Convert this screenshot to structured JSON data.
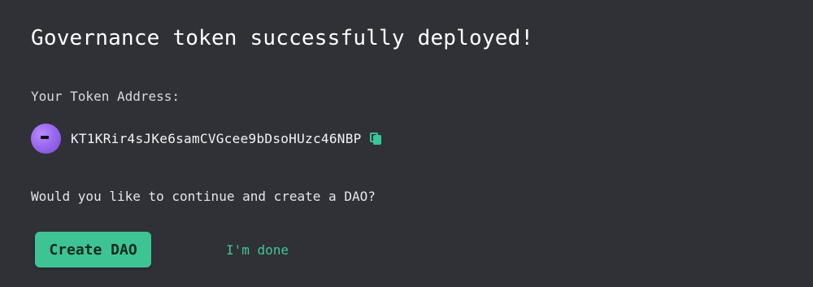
{
  "page": {
    "title": "Governance token successfully deployed!",
    "token_label": "Your Token Address:",
    "token_address": "KT1KRir4sJKe6samCVGcee9bDsoHUzc46NBP",
    "question": "Would you like to continue and create a DAO?",
    "create_button": "Create DAO",
    "done_link": "I'm done"
  },
  "icons": {
    "avatar": "avatar",
    "copy": "copy-icon"
  },
  "colors": {
    "background": "#2f3137",
    "accent": "#3ec494",
    "text": "#eceff4"
  }
}
